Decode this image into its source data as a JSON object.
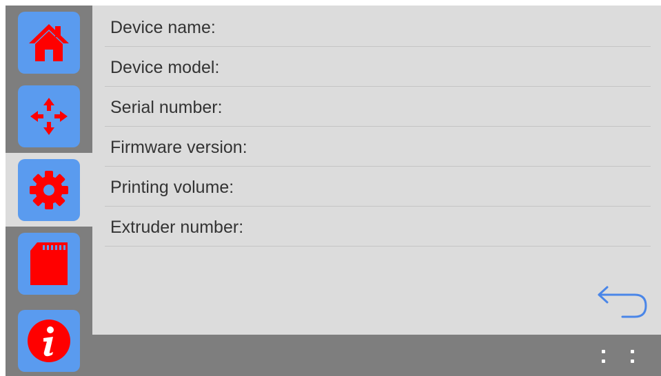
{
  "sidebar": {
    "items": [
      {
        "id": "home",
        "icon": "home-icon",
        "active": false
      },
      {
        "id": "move",
        "icon": "move-arrows-icon",
        "active": false
      },
      {
        "id": "settings",
        "icon": "gear-icon",
        "active": true
      },
      {
        "id": "sd-card",
        "icon": "sd-card-icon",
        "active": false
      },
      {
        "id": "info",
        "icon": "info-icon",
        "active": false
      }
    ]
  },
  "info_rows": [
    {
      "label": "Device name:"
    },
    {
      "label": "Device model:"
    },
    {
      "label": "Serial number:"
    },
    {
      "label": "Firmware version:"
    },
    {
      "label": "Printing volume:"
    },
    {
      "label": "Extruder number:"
    }
  ],
  "actions": {
    "back_icon": "back-arrow-icon",
    "menu_icon": "more-dots-icon"
  },
  "colors": {
    "icon_red": "#ff0000",
    "button_blue": "#5a9bef",
    "sidebar_gray": "#7e7e7e",
    "panel_gray": "#dcdcdc",
    "back_arrow_blue": "#4a86e8"
  }
}
